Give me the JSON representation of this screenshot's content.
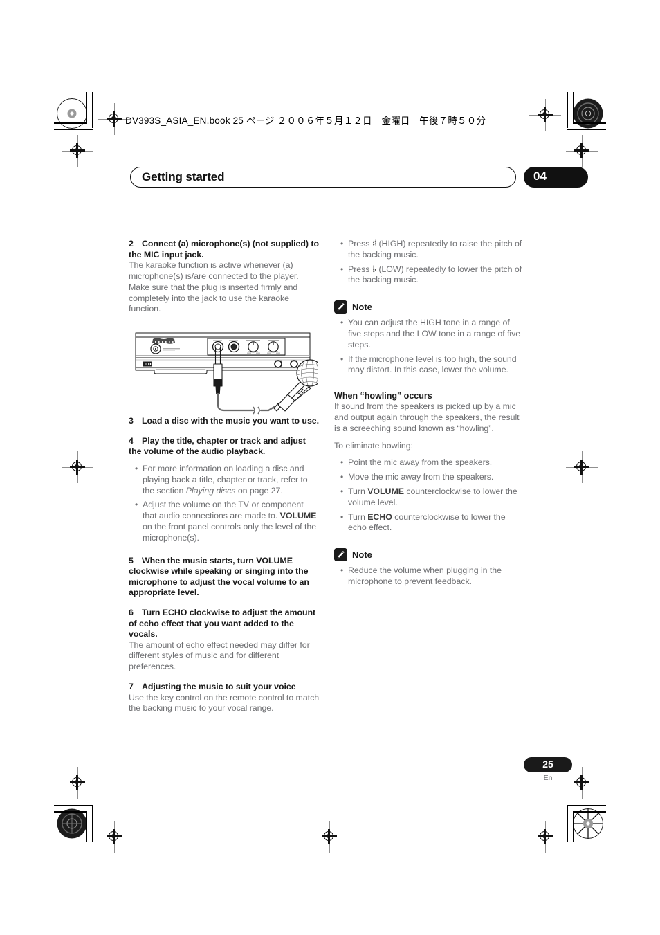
{
  "page": {
    "file_header": "DV393S_ASIA_EN.book  25 ページ  ２００６年５月１２日　金曜日　午後７時５０分",
    "running_head_title": "Getting started",
    "chapter_number": "04",
    "page_number": "25",
    "page_language": "En",
    "ink_black": "#111111",
    "body_gray": "#6d6e71"
  },
  "left_column": {
    "step2": {
      "number": "2",
      "heading": "Connect (a) microphone(s) (not supplied) to the MIC input jack.",
      "body": "The karaoke function is active whenever (a) microphone(s) is/are connected to the player. Make sure that the plug is inserted firmly and completely into the jack to use the karaoke function."
    },
    "illustration": {
      "name": "mic-connection-diagram",
      "brand_label": "Pioneer",
      "panel_controls": [
        "MIC 1",
        "MIC 2",
        "VOLUME",
        "ECHO"
      ],
      "knob_scale_min": "MIN",
      "knob_scale_max": "MAX",
      "disc_badge": "DVD"
    },
    "step3": {
      "number": "3",
      "heading": "Load a disc with the music you want to use."
    },
    "step4": {
      "number": "4",
      "heading": "Play the title, chapter or track and adjust the volume of the audio playback.",
      "bullets": [
        {
          "pre": "For more information on loading a disc and playing back a title, chapter or track, refer to the section ",
          "italic": "Playing discs",
          "post": " on page 27."
        },
        {
          "pre": "Adjust the volume on the TV or component that audio connections are made to. ",
          "bold": "VOLUME",
          "post": " on the front panel controls only the level of the microphone(s)."
        }
      ]
    },
    "step5": {
      "number": "5",
      "heading": "When the music starts, turn VOLUME clockwise while speaking or singing into the microphone to adjust the vocal volume to an appropriate level."
    },
    "step6": {
      "number": "6",
      "heading": "Turn ECHO clockwise to adjust the amount of echo effect that you want added to the vocals.",
      "body": "The amount of echo effect needed may differ for different styles of music and for different preferences."
    },
    "step7": {
      "number": "7",
      "heading": "Adjusting the music to suit your voice",
      "body": "Use the key control on the remote control to match the backing music to your vocal range."
    }
  },
  "right_column": {
    "pitch_bullets": [
      {
        "pre": "Press ",
        "symbol": "♯",
        "post": " (HIGH) repeatedly to raise the pitch of the backing music."
      },
      {
        "pre": "Press ",
        "symbol": "♭",
        "post": " (LOW) repeatedly to lower the pitch of the backing music."
      }
    ],
    "note1": {
      "label": "Note",
      "icon": "pencil-icon",
      "bullets": [
        "You can adjust the HIGH tone in a range of five steps and the LOW tone in a range of five steps.",
        "If the microphone level is too high, the sound may distort. In this case, lower the volume."
      ]
    },
    "howling": {
      "heading": "When “howling” occurs",
      "body": "If sound from the speakers is picked up by a mic and output again through the speakers, the result is a screeching sound known as “howling”.",
      "lead_in": "To eliminate howling:",
      "bullets": [
        {
          "text": "Point the mic away from the speakers."
        },
        {
          "text": "Move the mic away from the speakers."
        },
        {
          "pre": "Turn ",
          "bold": "VOLUME",
          "post": " counterclockwise to lower the volume level."
        },
        {
          "pre": "Turn ",
          "bold": "ECHO",
          "post": " counterclockwise to lower the echo effect."
        }
      ]
    },
    "note2": {
      "label": "Note",
      "icon": "pencil-icon",
      "bullets": [
        "Reduce the volume when plugging in the microphone to prevent feedback."
      ]
    }
  }
}
